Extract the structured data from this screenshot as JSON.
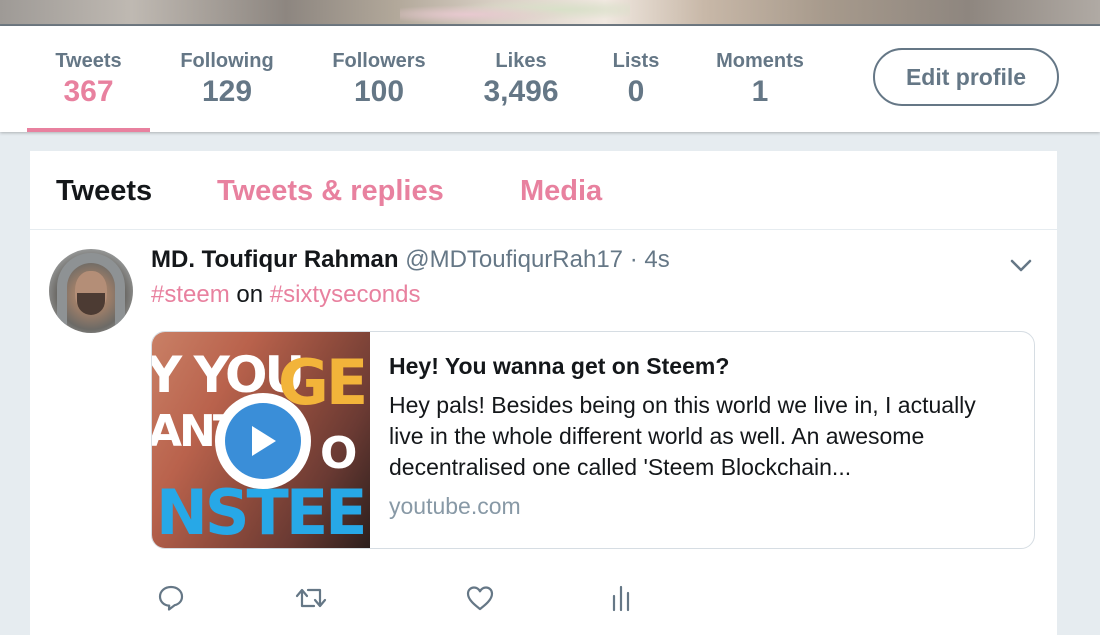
{
  "colors": {
    "accent": "#e8819f",
    "muted": "#657786",
    "text": "#14171a",
    "background": "#e6ecf0"
  },
  "profile_nav": {
    "stats": [
      {
        "label": "Tweets",
        "value": "367",
        "active": true
      },
      {
        "label": "Following",
        "value": "129"
      },
      {
        "label": "Followers",
        "value": "100"
      },
      {
        "label": "Likes",
        "value": "3,496"
      },
      {
        "label": "Lists",
        "value": "0"
      },
      {
        "label": "Moments",
        "value": "1"
      }
    ],
    "edit_profile_label": "Edit profile"
  },
  "timeline": {
    "tabs": [
      {
        "label": "Tweets",
        "active": true
      },
      {
        "label": "Tweets & replies"
      },
      {
        "label": "Media"
      }
    ],
    "tweet": {
      "name": "MD. Toufiqur Rahman",
      "handle": "@MDToufiqurRah17",
      "separator": "·",
      "time": "4s",
      "hashtag_1": "#steem",
      "connector": "on",
      "hashtag_2": "#sixtyseconds",
      "card": {
        "thumbnail_words": [
          "Y YOU",
          "ANT",
          "NSTEE",
          "GE",
          "O"
        ],
        "title": "Hey! You wanna get on Steem?",
        "description_lines": [
          "Hey pals! Besides being on this world we live in, I actually",
          "live in the whole different world as well. An awesome",
          "decentralised one called 'Steem Blockchain..."
        ],
        "domain": "youtube.com"
      },
      "actions": [
        "reply-icon",
        "retweet-icon",
        "like-icon",
        "analytics-icon"
      ]
    }
  }
}
